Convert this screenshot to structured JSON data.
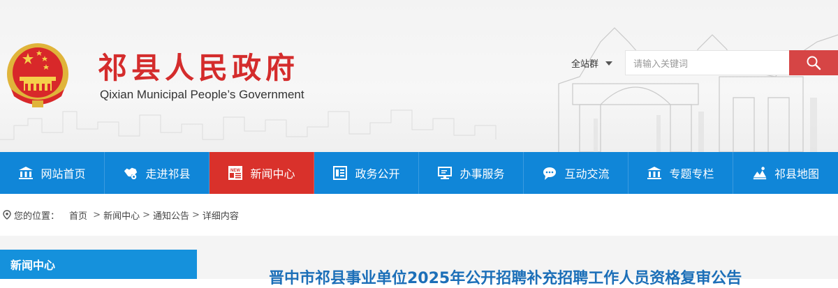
{
  "header": {
    "title_cn": "祁县人民政府",
    "title_en": "Qixian Municipal People’s Government",
    "site_group_label": "全站群",
    "search_placeholder": "请输入关键词"
  },
  "nav": {
    "items": [
      {
        "label": "网站首页",
        "icon": "bank-icon",
        "active": false
      },
      {
        "label": "走进祁县",
        "icon": "map-region-icon",
        "active": false
      },
      {
        "label": "新闻中心",
        "icon": "news-icon",
        "active": true
      },
      {
        "label": "政务公开",
        "icon": "document-icon",
        "active": false
      },
      {
        "label": "办事服务",
        "icon": "monitor-icon",
        "active": false
      },
      {
        "label": "互动交流",
        "icon": "chat-icon",
        "active": false
      },
      {
        "label": "专题专栏",
        "icon": "bank-icon",
        "active": false
      },
      {
        "label": "祁县地图",
        "icon": "landscape-icon",
        "active": false
      }
    ],
    "colors": {
      "bar": "#1086d8",
      "active": "#d9312b"
    }
  },
  "breadcrumb": {
    "prefix": "您的位置：",
    "items": [
      "首页",
      "新闻中心",
      "通知公告",
      "详细内容"
    ]
  },
  "sidebar": {
    "heading": "新闻中心"
  },
  "article": {
    "title": "晋中市祁县事业单位2025年公开招聘补充招聘工作人员资格复审公告"
  }
}
